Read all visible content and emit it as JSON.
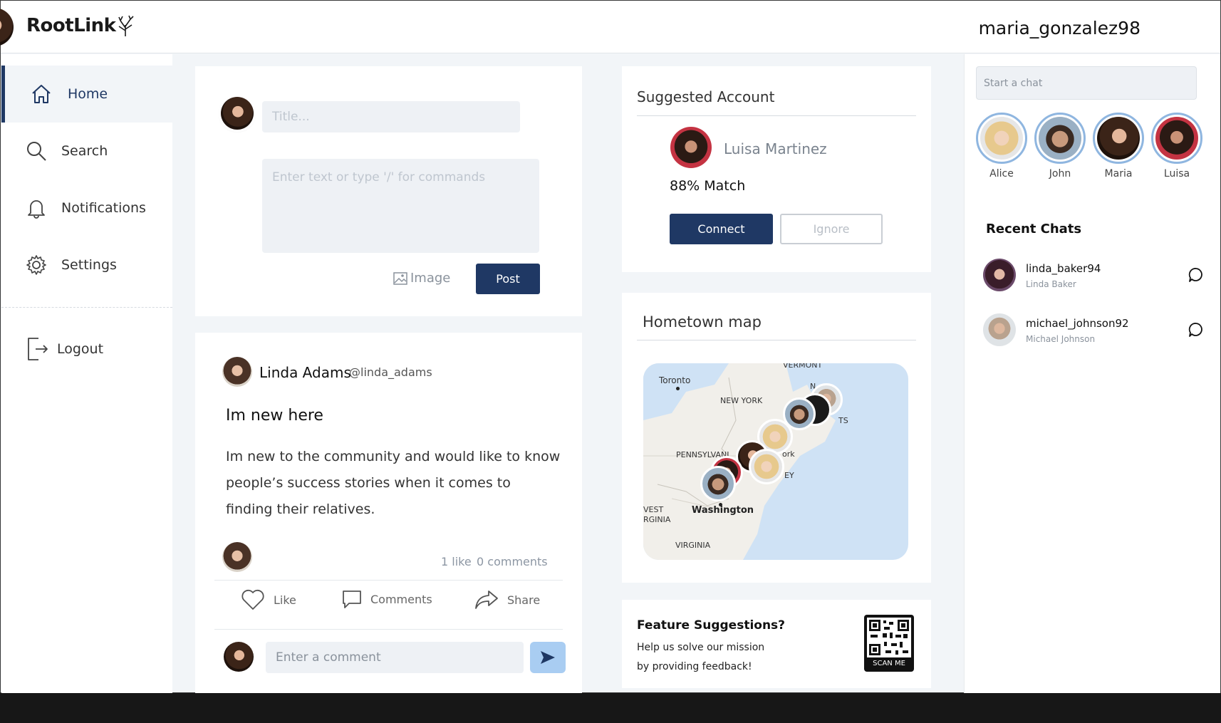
{
  "app": {
    "name": "RootLink"
  },
  "header": {
    "username": "maria_gonzalez98"
  },
  "sidebar": {
    "items": [
      {
        "label": "Home",
        "icon": "home-icon",
        "active": true
      },
      {
        "label": "Search",
        "icon": "search-icon"
      },
      {
        "label": "Notifications",
        "icon": "bell-icon"
      },
      {
        "label": "Settings",
        "icon": "gear-icon"
      }
    ],
    "logout": {
      "label": "Logout",
      "icon": "logout-icon"
    }
  },
  "composer": {
    "title_placeholder": "Title...",
    "body_placeholder": "Enter text or type '/' for commands",
    "image_label": "Image",
    "post_label": "Post"
  },
  "post": {
    "author": "Linda Adams",
    "handle": "@linda_adams",
    "title": "Im new here",
    "body": "Im new to the community and would like to know people’s success stories when it comes to finding their relatives.",
    "likes": "1 like",
    "comments": "0 comments",
    "actions": {
      "like": "Like",
      "comments": "Comments",
      "share": "Share"
    },
    "comment_placeholder": "Enter a comment"
  },
  "suggested": {
    "title": "Suggested Account",
    "name": "Luisa Martinez",
    "match": "88% Match",
    "connect": "Connect",
    "ignore": "Ignore"
  },
  "map": {
    "title": "Hometown map",
    "labels": {
      "toronto": "Toronto",
      "vermont": "VERMONT",
      "new_york": "NEW YORK",
      "pennsylvania": "PENNSYLVANI",
      "york": "ork",
      "ey": "EY",
      "ts": "TS",
      "n": "N",
      "west_virginia_1": "VEST",
      "west_virginia_2": "RGINIA",
      "washington": "Washington",
      "virginia": "VIRGINIA"
    },
    "colors": {
      "water": "#cfe2f5",
      "land": "#f1efea"
    }
  },
  "feedback": {
    "title": "Feature Suggestions?",
    "line1": "Help us solve our mission",
    "line2": "by providing feedback!",
    "qr_label": "SCAN ME"
  },
  "chat": {
    "placeholder": "Start a chat",
    "stories": [
      "Alice",
      "John",
      "Maria",
      "Luisa"
    ],
    "recent_title": "Recent Chats",
    "recent": [
      {
        "username": "linda_baker94",
        "name": "Linda Baker"
      },
      {
        "username": "michael_johnson92",
        "name": "Michael Johnson"
      }
    ]
  },
  "colors": {
    "brand": "#1f3864",
    "accent": "#8fb6e0",
    "send": "#a9cdf2"
  }
}
